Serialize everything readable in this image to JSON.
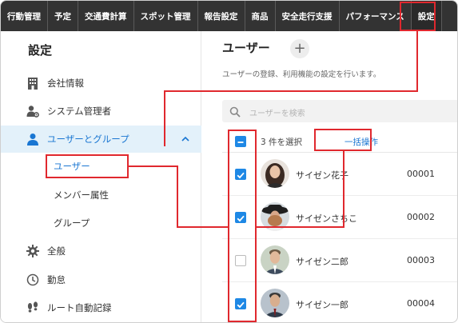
{
  "nav": {
    "items": [
      "行動管理",
      "予定",
      "交通費計算",
      "スポット管理",
      "報告設定",
      "商品",
      "安全走行支援",
      "パフォーマンス",
      "設定"
    ]
  },
  "sidebar": {
    "title": "設定",
    "items": [
      {
        "label": "会社情報",
        "icon": "building-icon"
      },
      {
        "label": "システム管理者",
        "icon": "admin-user-gear-icon"
      },
      {
        "label": "ユーザーとグループ",
        "icon": "person-icon"
      },
      {
        "label": "ユーザー"
      },
      {
        "label": "メンバー属性"
      },
      {
        "label": "グループ"
      },
      {
        "label": "全般",
        "icon": "gear-icon"
      },
      {
        "label": "勤怠",
        "icon": "clock-icon"
      },
      {
        "label": "ルート自動記録",
        "icon": "footprints-icon"
      }
    ]
  },
  "main": {
    "title": "ユーザー",
    "add_symbol": "+",
    "description": "ユーザーの登録、利用機能の設定を行います。",
    "search_placeholder": "ユーザーを検索",
    "selection": {
      "count_text": "3 件を選択",
      "bulk_label": "一括操作"
    },
    "users": [
      {
        "name": "サイゼン花子",
        "code": "00001",
        "checked": true
      },
      {
        "name": "サイゼンさちこ",
        "code": "00002",
        "checked": true
      },
      {
        "name": "サイゼン二郎",
        "code": "00003",
        "checked": false
      },
      {
        "name": "サイゼン一郎",
        "code": "00004",
        "checked": true
      }
    ]
  },
  "colors": {
    "accent": "#1e88e5",
    "annotation": "#e0282e",
    "nav_bg": "#333333",
    "group_bg": "#e3f1fa"
  }
}
